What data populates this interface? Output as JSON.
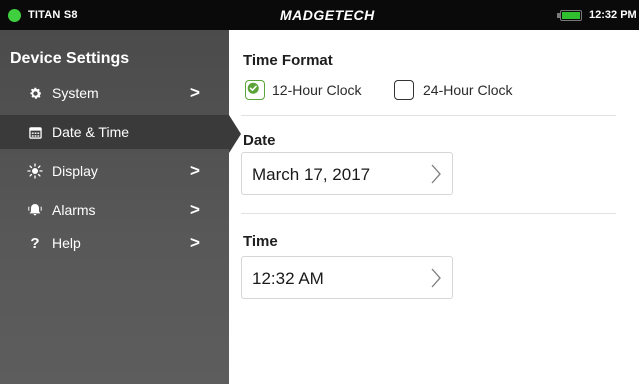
{
  "statusbar": {
    "device_name": "TITAN S8",
    "brand": "MADGETECH",
    "time": "12:32 PM",
    "status_color": "#3fcf3f",
    "battery_color": "#2fbf2f"
  },
  "sidebar": {
    "title": "Device Settings",
    "items": [
      {
        "label": "System",
        "icon": "gear-icon",
        "has_chevron": true
      },
      {
        "label": "Date & Time",
        "icon": "calendar-icon",
        "active": true,
        "has_chevron": false
      },
      {
        "label": "Display",
        "icon": "brightness-icon",
        "has_chevron": true
      },
      {
        "label": "Alarms",
        "icon": "alarm-bell-icon",
        "has_chevron": true
      },
      {
        "label": "Help",
        "icon": "question-icon",
        "has_chevron": true
      }
    ],
    "chevron": ">",
    "help_glyph": "?"
  },
  "main": {
    "time_format": {
      "title": "Time Format",
      "options": [
        {
          "label": "12-Hour Clock",
          "checked": true
        },
        {
          "label": "24-Hour Clock",
          "checked": false
        }
      ]
    },
    "date": {
      "title": "Date",
      "value": "March 17, 2017"
    },
    "time": {
      "title": "Time",
      "value": "12:32 AM"
    }
  },
  "colors": {
    "accent_check": "#5aa43a",
    "sidebar_bg": "#555555",
    "sidebar_active": "#3a3a3a"
  }
}
